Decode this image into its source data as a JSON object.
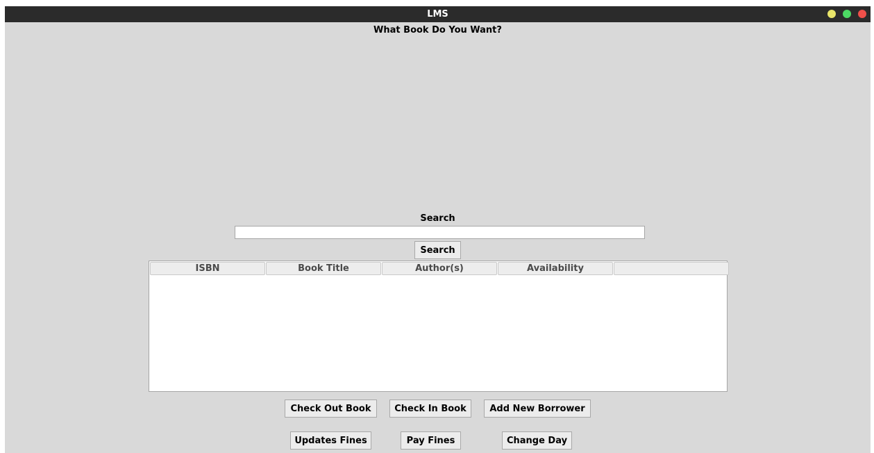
{
  "window": {
    "title": "LMS",
    "controls": [
      "minimize-icon",
      "maximize-icon",
      "close-icon"
    ],
    "control_colors": [
      "#e9e56a",
      "#4cd964",
      "#f0504a"
    ]
  },
  "heading": "What Book Do You Want?",
  "search": {
    "label": "Search",
    "value": "",
    "button_label": "Search"
  },
  "table": {
    "columns": [
      "ISBN",
      "Book Title",
      "Author(s)",
      "Availability",
      ""
    ],
    "rows": []
  },
  "actions": {
    "check_out": "Check Out Book",
    "check_in": "Check In Book",
    "add_borrower": "Add New Borrower",
    "update_fines": "Updates Fines",
    "pay_fines": "Pay Fines",
    "change_day": "Change Day"
  }
}
